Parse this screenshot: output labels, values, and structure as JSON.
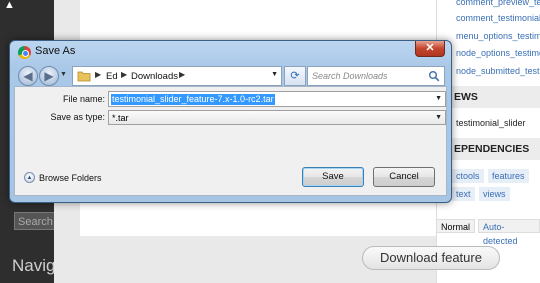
{
  "background": {
    "sidebar_links": [
      "comment_preview_tes",
      "comment_testimonial",
      "menu_options_testim",
      "node_options_testimo",
      "node_submitted_testi"
    ],
    "views_heading": "EWS",
    "views_item": "testimonial_slider",
    "dependencies_heading": "EPENDENCIES",
    "dependency_tags": [
      "ctools",
      "features",
      "text",
      "views"
    ],
    "status_pills": [
      "Normal",
      "Auto-detected"
    ],
    "search_button": "Search",
    "nav_heading": "Navig",
    "download_button": "Download feature"
  },
  "dialog": {
    "title": "Save As",
    "close_label": "✕",
    "address_parts": [
      "Ed",
      "Downloads"
    ],
    "search_placeholder": "Search Downloads",
    "file_name_label": "File name:",
    "file_name_value": "testimonial_slider_feature-7.x-1.0-rc2.tar",
    "save_as_type_label": "Save as type:",
    "save_as_type_value": "*.tar",
    "browse_folders": "Browse Folders",
    "save_button": "Save",
    "cancel_button": "Cancel"
  },
  "icons": {
    "back": "back-arrow-icon",
    "forward": "forward-arrow-icon",
    "folder": "folder-icon",
    "refresh": "refresh-icon",
    "search": "search-icon",
    "expand": "expand-icon"
  },
  "colors": {
    "selection": "#3399ff",
    "dialog_frame": "#a9c8e7",
    "close_button": "#c4452e",
    "link": "#3a6fb5"
  }
}
